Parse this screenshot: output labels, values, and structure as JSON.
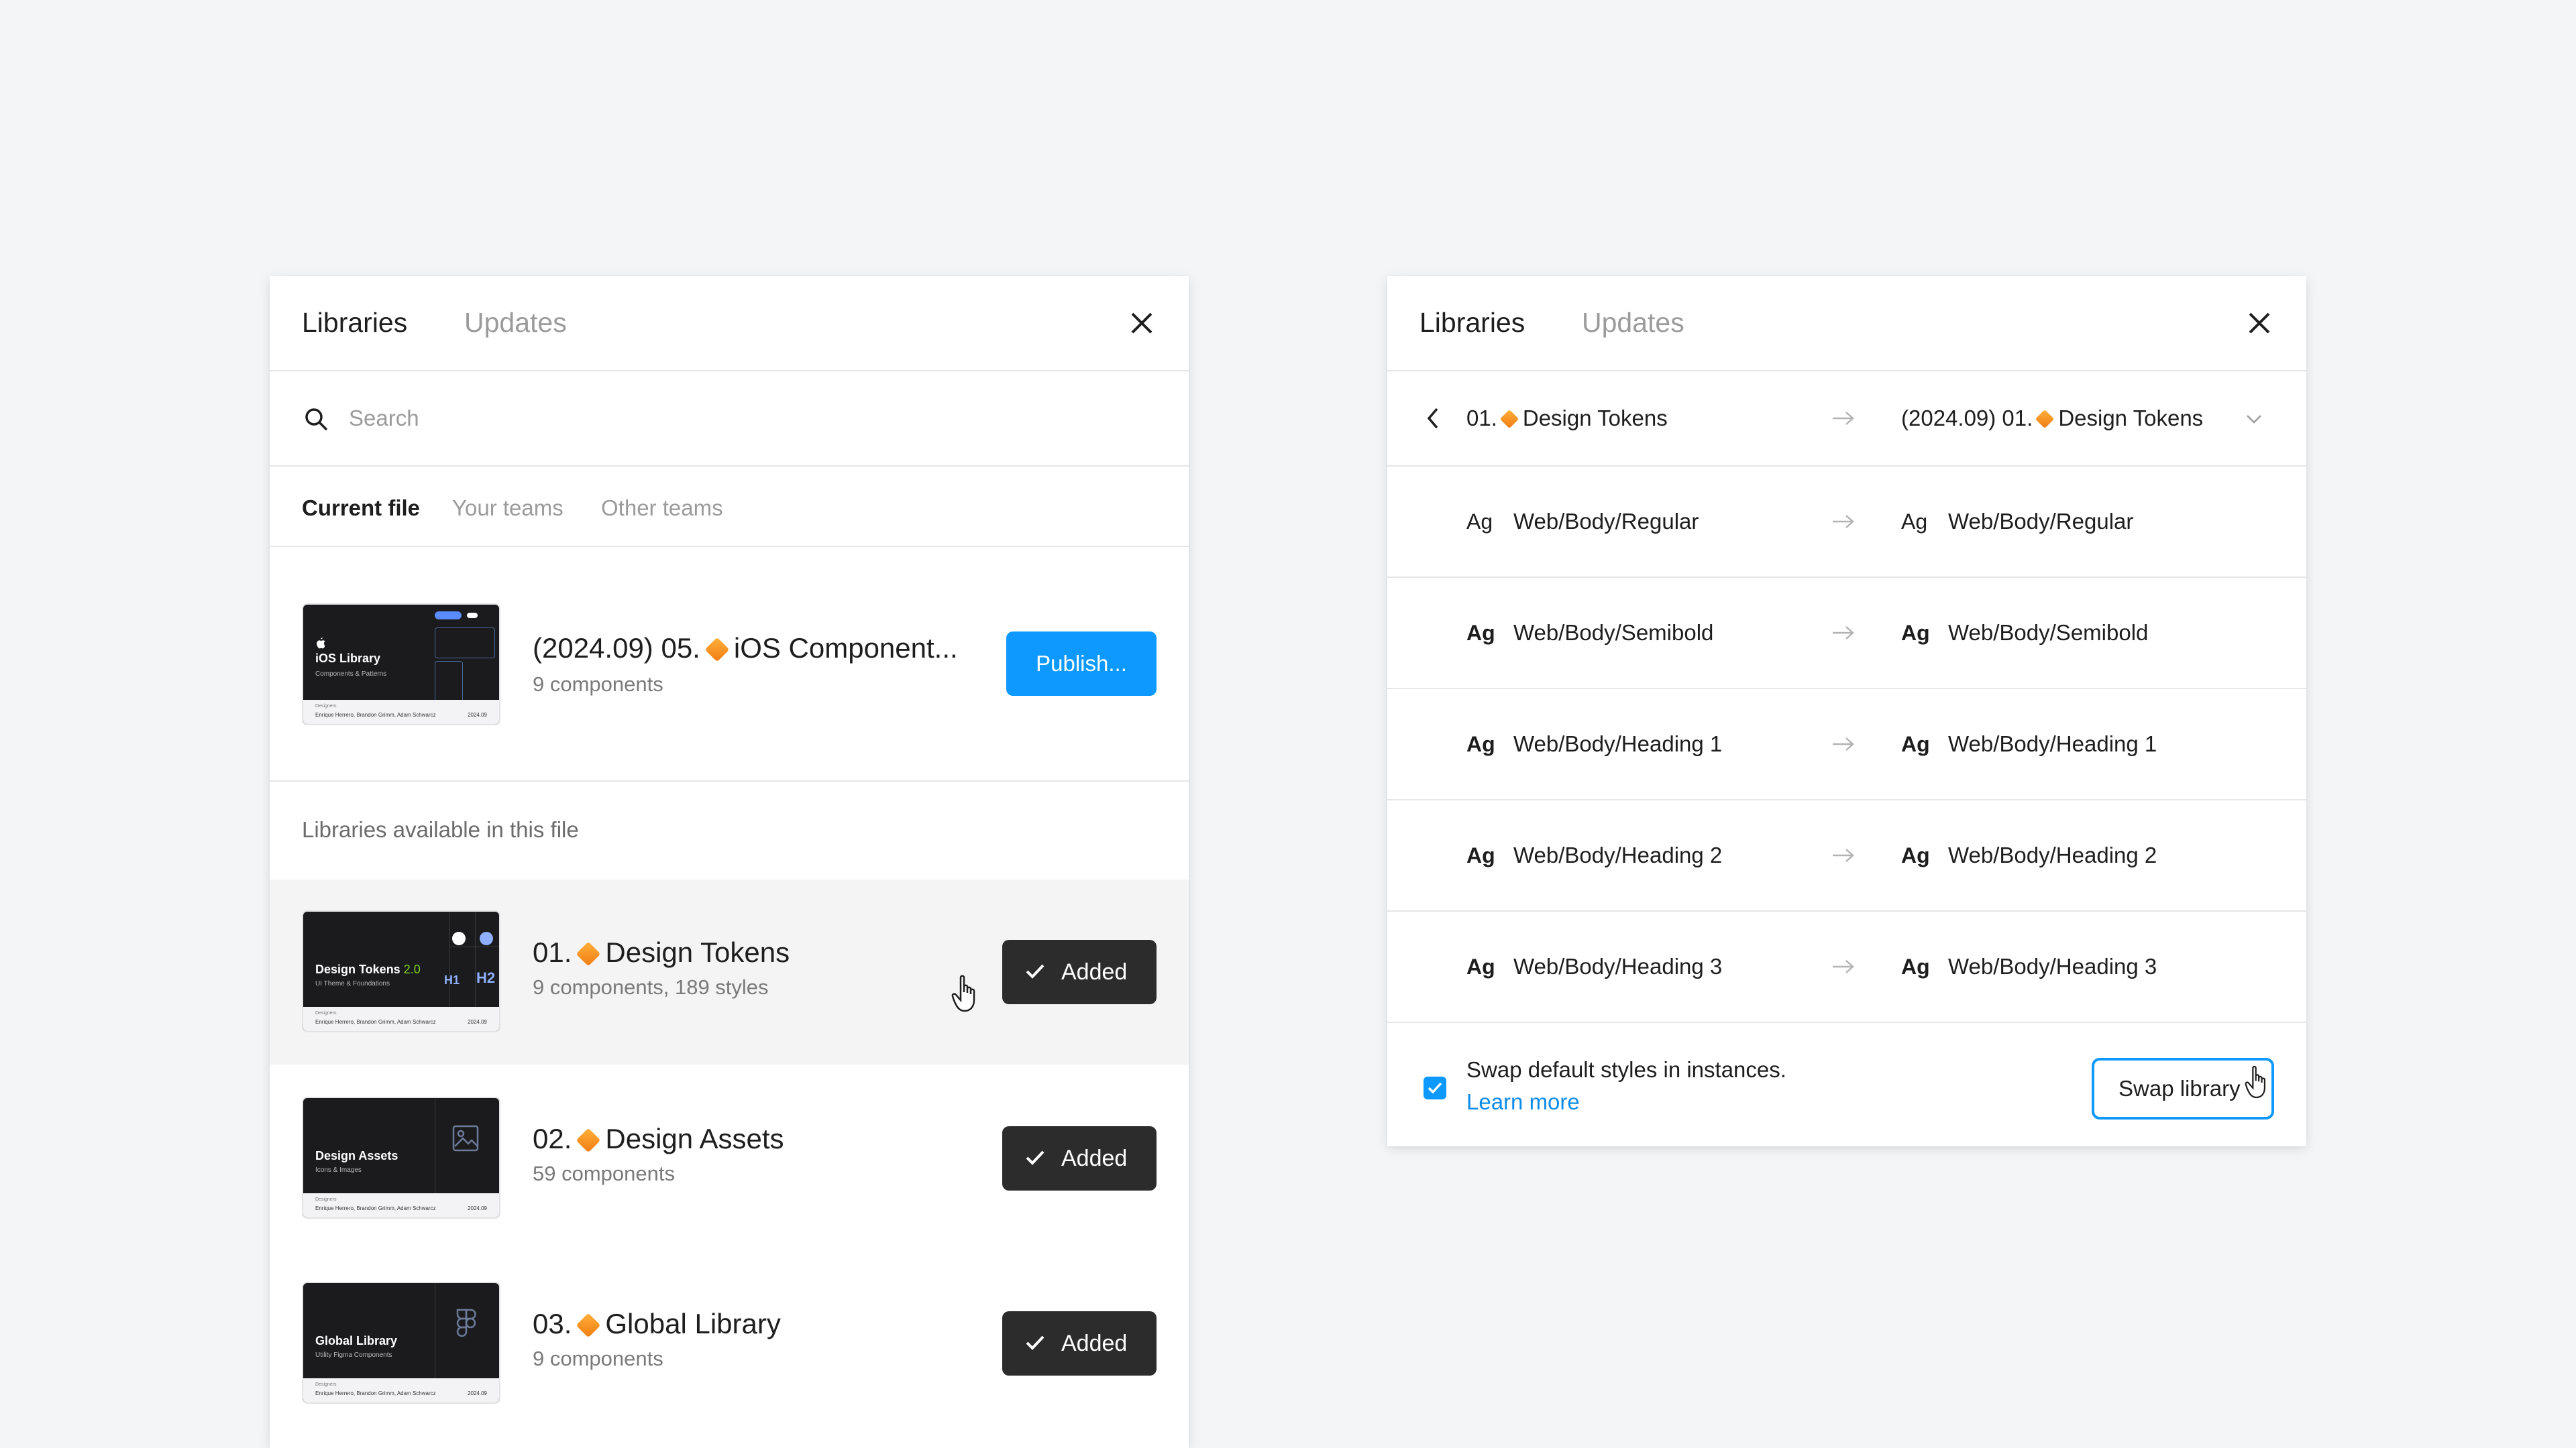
{
  "left_panel": {
    "tabs": [
      "Libraries",
      "Updates"
    ],
    "search_placeholder": "Search",
    "filters": [
      "Current file",
      "Your teams",
      "Other teams"
    ],
    "current": {
      "name_prefix": "(2024.09) 05.",
      "name_suffix": "iOS Component...",
      "sub": "9 components",
      "publish_label": "Publish...",
      "thumb_title": "iOS Library",
      "thumb_sub": "Components & Patterns",
      "thumb_designers": "Designers",
      "thumb_names": "Enrique Herrero, Brandon Grimm, Adam Schwarcz",
      "thumb_date": "2024.09"
    },
    "section_label": "Libraries available in this file",
    "libraries": [
      {
        "prefix": "01.",
        "name": "Design Tokens",
        "sub": "9 components, 189 styles",
        "status": "Added",
        "thumb_title": "Design Tokens",
        "thumb_badge": "2.0",
        "thumb_sub": "UI Theme & Foundations",
        "thumb_h1": "H1",
        "thumb_h2": "H2"
      },
      {
        "prefix": "02.",
        "name": "Design Assets",
        "sub": "59 components",
        "status": "Added",
        "thumb_title": "Design Assets",
        "thumb_sub": "Icons & Images"
      },
      {
        "prefix": "03.",
        "name": "Global Library",
        "sub": "9 components",
        "status": "Added",
        "thumb_title": "Global Library",
        "thumb_sub": "Utility Figma Components"
      }
    ],
    "thumb_designers": "Designers",
    "thumb_names": "Enrique Herrero, Brandon Grimm, Adam Schwarcz",
    "thumb_date": "2024.09"
  },
  "right_panel": {
    "tabs": [
      "Libraries",
      "Updates"
    ],
    "from_prefix": "01.",
    "from_name": "Design Tokens",
    "to_prefix": "(2024.09) 01.",
    "to_name": "Design Tokens",
    "ag": "Ag",
    "styles": [
      {
        "from": "Web/Body/Regular",
        "to": "Web/Body/Regular",
        "bold": false
      },
      {
        "from": "Web/Body/Semibold",
        "to": "Web/Body/Semibold",
        "bold": true
      },
      {
        "from": "Web/Body/Heading 1",
        "to": "Web/Body/Heading 1",
        "bold": true
      },
      {
        "from": "Web/Body/Heading 2",
        "to": "Web/Body/Heading 2",
        "bold": true
      },
      {
        "from": "Web/Body/Heading 3",
        "to": "Web/Body/Heading 3",
        "bold": true
      }
    ],
    "checkbox_label": "Swap default styles in instances.",
    "checkbox_checked": true,
    "learn_more": "Learn more",
    "swap_label": "Swap library"
  },
  "colors": {
    "accent": "#0d99ff",
    "dark_button": "#2c2c2c",
    "diamond": "#f59a23",
    "tokens_badge": "#7ed321"
  }
}
